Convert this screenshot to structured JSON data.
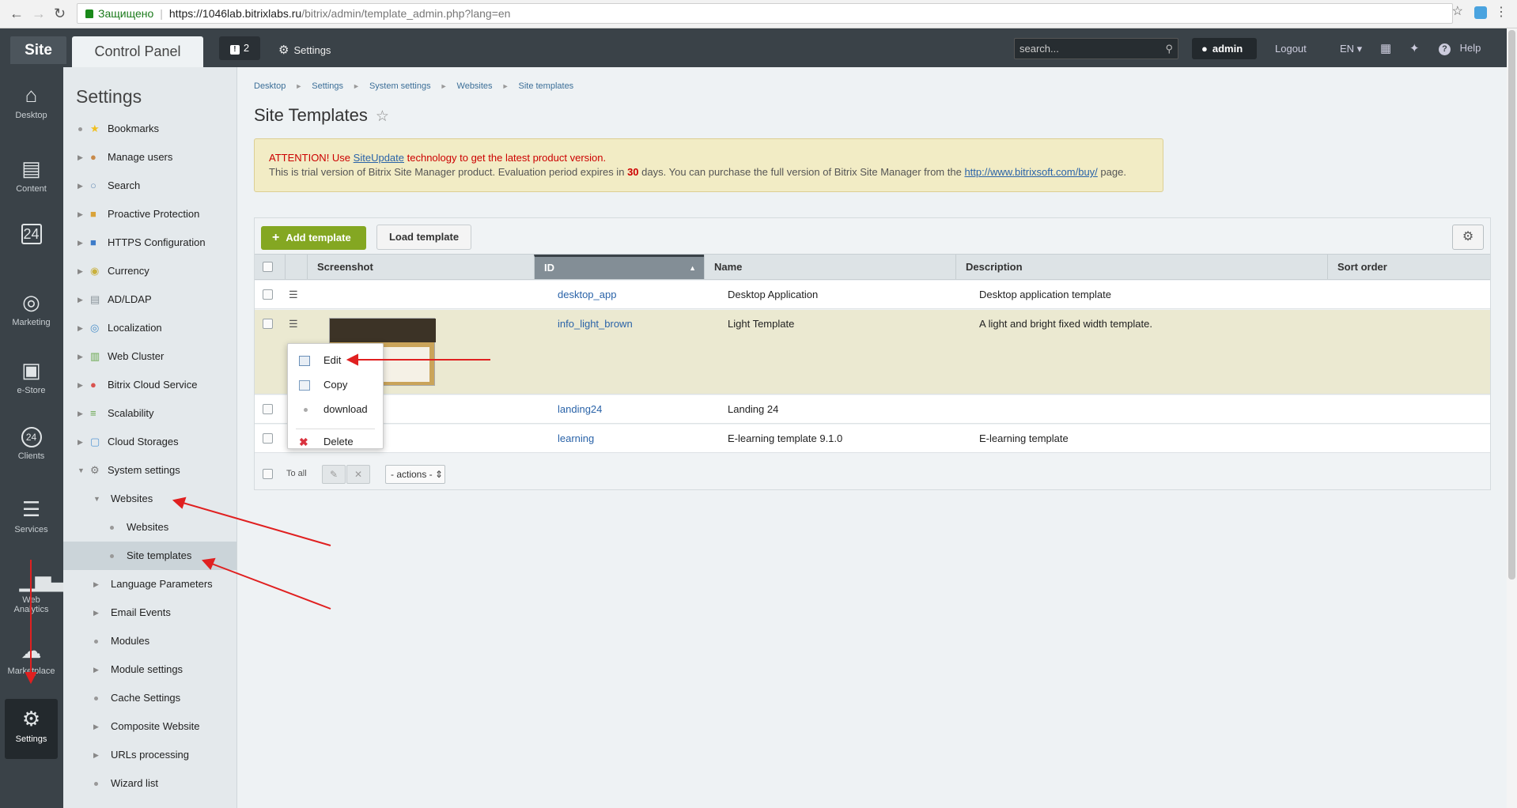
{
  "browser": {
    "secure_label": "Защищено",
    "url_host": "https://1046lab.bitrixlabs.ru",
    "url_path": "/bitrix/admin/template_admin.php?lang=en"
  },
  "topbar": {
    "site_tab": "Site",
    "control_panel_tab": "Control Panel",
    "notify_count": "2",
    "settings_link": "Settings",
    "search_placeholder": "search...",
    "user": "admin",
    "logout": "Logout",
    "lang": "EN",
    "help": "Help"
  },
  "rail": [
    {
      "label": "Desktop",
      "icon": "home-icon"
    },
    {
      "label": "Content",
      "icon": "document-icon"
    },
    {
      "label": "",
      "icon": "calendar-24-icon"
    },
    {
      "label": "Marketing",
      "icon": "target-icon"
    },
    {
      "label": "e-Store",
      "icon": "basket-icon"
    },
    {
      "label": "Clients",
      "icon": "clients-24-icon"
    },
    {
      "label": "Services",
      "icon": "layers-icon"
    },
    {
      "label": "Web Analytics",
      "icon": "bar-chart-icon"
    },
    {
      "label": "Marketplace",
      "icon": "cloud-icon"
    },
    {
      "label": "Settings",
      "icon": "gear-icon"
    }
  ],
  "sidebar": {
    "title": "Settings",
    "items": [
      {
        "label": "Bookmarks",
        "level": 0,
        "marker": "dot",
        "icon": "star-icon",
        "color": "#f0c020"
      },
      {
        "label": "Manage users",
        "level": 0,
        "marker": "arrow",
        "icon": "user-icon",
        "color": "#c88a4a"
      },
      {
        "label": "Search",
        "level": 0,
        "marker": "arrow",
        "icon": "search-icon",
        "color": "#6a8fb8"
      },
      {
        "label": "Proactive Protection",
        "level": 0,
        "marker": "arrow",
        "icon": "lock-icon",
        "color": "#d9a33a"
      },
      {
        "label": "HTTPS Configuration",
        "level": 0,
        "marker": "arrow",
        "icon": "https-lock-icon",
        "color": "#3d7cc9"
      },
      {
        "label": "Currency",
        "level": 0,
        "marker": "arrow",
        "icon": "coin-icon",
        "color": "#c9b03d"
      },
      {
        "label": "AD/LDAP",
        "level": 0,
        "marker": "arrow",
        "icon": "directory-icon",
        "color": "#8a949a"
      },
      {
        "label": "Localization",
        "level": 0,
        "marker": "arrow",
        "icon": "globe-icon",
        "color": "#4a8fc9"
      },
      {
        "label": "Web Cluster",
        "level": 0,
        "marker": "arrow",
        "icon": "cluster-icon",
        "color": "#6aa84f"
      },
      {
        "label": "Bitrix Cloud Service",
        "level": 0,
        "marker": "arrow",
        "icon": "cloud-service-icon",
        "color": "#d9534f"
      },
      {
        "label": "Scalability",
        "level": 0,
        "marker": "arrow",
        "icon": "scalability-icon",
        "color": "#6aa84f"
      },
      {
        "label": "Cloud Storages",
        "level": 0,
        "marker": "arrow",
        "icon": "cloud-storage-icon",
        "color": "#5b9bd5"
      },
      {
        "label": "System settings",
        "level": 0,
        "marker": "open",
        "icon": "gear-icon",
        "color": "#777777"
      },
      {
        "label": "Websites",
        "level": 1,
        "marker": "open",
        "icon": "",
        "color": ""
      },
      {
        "label": "Websites",
        "level": 2,
        "marker": "dot",
        "icon": "",
        "color": ""
      },
      {
        "label": "Site templates",
        "level": 2,
        "marker": "dot",
        "icon": "",
        "color": "",
        "active": true
      },
      {
        "label": "Language Parameters",
        "level": 1,
        "marker": "arrow",
        "icon": "",
        "color": ""
      },
      {
        "label": "Email Events",
        "level": 1,
        "marker": "arrow",
        "icon": "",
        "color": ""
      },
      {
        "label": "Modules",
        "level": 1,
        "marker": "dot",
        "icon": "",
        "color": ""
      },
      {
        "label": "Module settings",
        "level": 1,
        "marker": "arrow",
        "icon": "",
        "color": ""
      },
      {
        "label": "Cache Settings",
        "level": 1,
        "marker": "dot",
        "icon": "",
        "color": ""
      },
      {
        "label": "Composite Website",
        "level": 1,
        "marker": "arrow",
        "icon": "",
        "color": ""
      },
      {
        "label": "URLs processing",
        "level": 1,
        "marker": "arrow",
        "icon": "",
        "color": ""
      },
      {
        "label": "Wizard list",
        "level": 1,
        "marker": "dot",
        "icon": "",
        "color": ""
      }
    ]
  },
  "breadcrumbs": [
    "Desktop",
    "Settings",
    "System settings",
    "Websites",
    "Site templates"
  ],
  "page_title": "Site Templates",
  "warning": {
    "attention": "ATTENTION! Use",
    "link1": "SiteUpdate",
    "attention_tail": "technology to get the latest product version.",
    "trial_text": "This is trial version of Bitrix Site Manager product. Evaluation period expires in",
    "days": "30",
    "trial_mid": "days. You can purchase the full version of Bitrix Site Manager from the",
    "link2": "http://www.bitrixsoft.com/buy/",
    "trial_tail": "page."
  },
  "toolbar": {
    "add": "Add template",
    "load": "Load template"
  },
  "table": {
    "columns": [
      "Screenshot",
      "ID",
      "Name",
      "Description",
      "Sort order"
    ],
    "rows": [
      {
        "id": "desktop_app",
        "name": "Desktop Application",
        "description": "Desktop application template"
      },
      {
        "id": "info_light_brown",
        "name": "Light Template",
        "description": "A light and bright fixed width template."
      },
      {
        "id": "landing24",
        "name": "Landing 24",
        "description": ""
      },
      {
        "id": "learning",
        "name": "E-learning template 9.1.0",
        "description": "E-learning template"
      }
    ],
    "to_all": "To all",
    "actions": "- actions -"
  },
  "context_menu": [
    {
      "label": "Edit",
      "icon": "edit-icon"
    },
    {
      "label": "Copy",
      "icon": "copy-icon"
    },
    {
      "label": "download",
      "icon": "dot-icon"
    },
    {
      "label": "Delete",
      "icon": "delete-icon"
    }
  ],
  "colors": {
    "accent_green": "#84a722",
    "annotation_red": "#e02020",
    "topbar": "#3a4248"
  }
}
